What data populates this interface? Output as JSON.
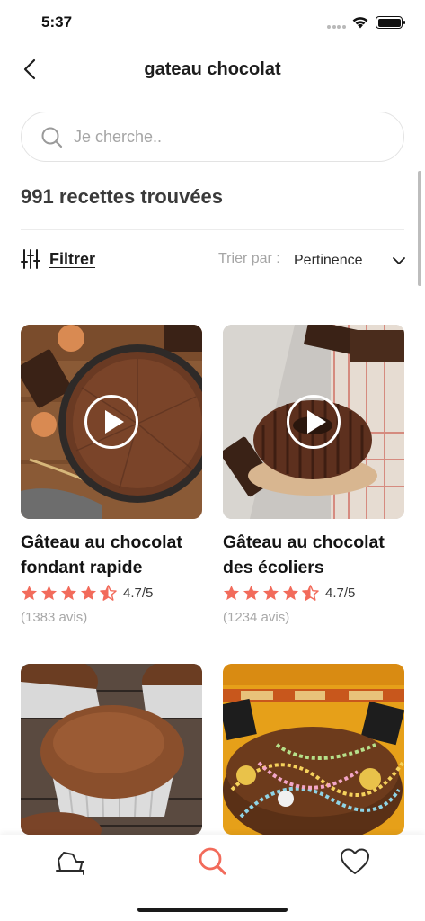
{
  "status_bar": {
    "time": "5:37"
  },
  "header": {
    "title": "gateau chocolat"
  },
  "search": {
    "value": "",
    "placeholder": "Je cherche.."
  },
  "results": {
    "count_text": "991 recettes trouvées"
  },
  "toolbar": {
    "filter_label": "Filtrer",
    "sort_prefix": "Trier par :",
    "sort_value": "Pertinence"
  },
  "recipes": [
    {
      "title": "Gâteau au chocolat fondant rapide",
      "rating": "4.7/5",
      "stars": 4.5,
      "reviews": "(1383 avis)",
      "has_video": true
    },
    {
      "title": "Gâteau au chocolat des écoliers",
      "rating": "4.7/5",
      "stars": 4.5,
      "reviews": "(1234 avis)",
      "has_video": true
    },
    {
      "has_video": false
    },
    {
      "has_video": false
    }
  ],
  "tab_bar": {
    "items": [
      {
        "icon": "pot-icon",
        "active": false
      },
      {
        "icon": "search-icon",
        "active": true
      },
      {
        "icon": "heart-icon",
        "active": false
      }
    ]
  },
  "colors": {
    "accent": "#f26b5b",
    "star": "#f26b5b",
    "text_primary": "#1d1d1d",
    "text_muted": "#a5a5a5",
    "border": "#e3e3e3"
  }
}
